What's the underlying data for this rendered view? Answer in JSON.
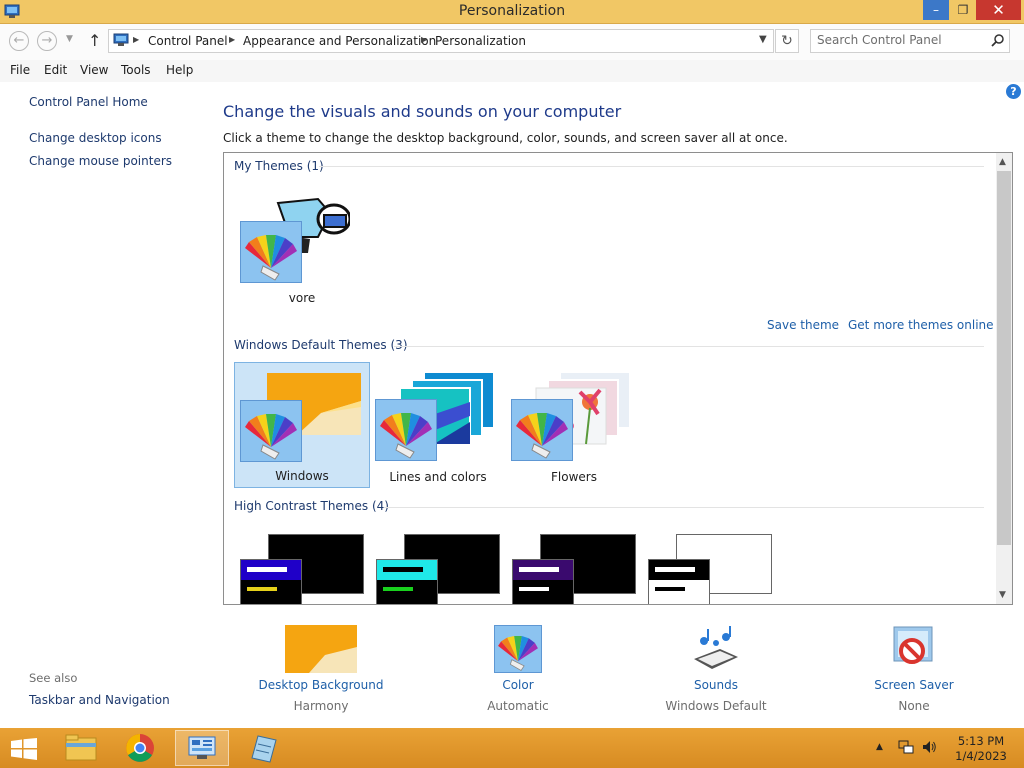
{
  "window": {
    "title": "Personalization",
    "minimize_glyph": "–",
    "maximize_glyph": "❐",
    "close_glyph": "✕"
  },
  "addressbar": {
    "breadcrumbs": [
      "Control Panel",
      "Appearance and Personalization",
      "Personalization"
    ],
    "search_placeholder": "Search Control Panel"
  },
  "menubar": {
    "items": [
      "File",
      "Edit",
      "View",
      "Tools",
      "Help"
    ]
  },
  "sidebar": {
    "home_link": "Control Panel Home",
    "links": [
      "Change desktop icons",
      "Change mouse pointers"
    ],
    "see_also_label": "See also",
    "see_also_links": [
      "Taskbar and Navigation"
    ]
  },
  "main": {
    "heading": "Change the visuals and sounds on your computer",
    "subtext": "Click a theme to change the desktop background, color, sounds, and screen saver all at once.",
    "my_themes": {
      "title": "My Themes (1)",
      "themes": [
        {
          "name": "vore"
        }
      ],
      "save_link": "Save theme",
      "online_link": "Get more themes online"
    },
    "default_themes": {
      "title": "Windows Default Themes (3)",
      "themes": [
        {
          "name": "Windows",
          "selected": true
        },
        {
          "name": "Lines and colors",
          "selected": false
        },
        {
          "name": "Flowers",
          "selected": false
        }
      ]
    },
    "high_contrast": {
      "title": "High Contrast Themes (4)"
    }
  },
  "bottom": {
    "items": [
      {
        "title": "Desktop Background",
        "value": "Harmony"
      },
      {
        "title": "Color",
        "value": "Automatic"
      },
      {
        "title": "Sounds",
        "value": "Windows Default"
      },
      {
        "title": "Screen Saver",
        "value": "None"
      }
    ]
  },
  "taskbar": {
    "time": "5:13 PM",
    "date": "1/4/2023"
  },
  "colors": {
    "titlebar": "#f1c765",
    "taskbar": "#e09a2c",
    "link": "#1e5fa8",
    "selection": "#cce4f7"
  }
}
